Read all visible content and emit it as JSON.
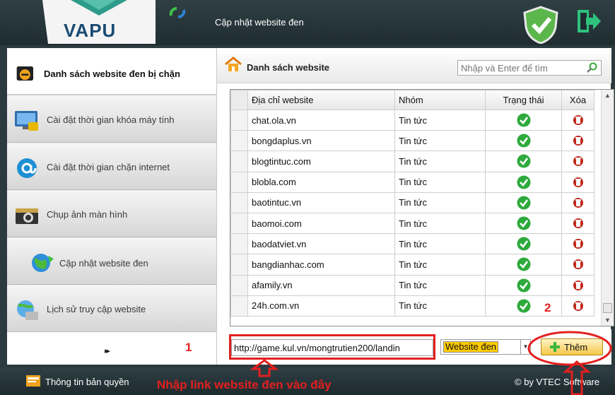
{
  "header": {
    "logo": "VAPU",
    "title": "Cập nhật website đen"
  },
  "sidebar": {
    "items": [
      {
        "label": "Danh sách website đen bị chặn",
        "icon": "blocked-sites-icon"
      },
      {
        "label": "Cài đặt thời gian khóa máy tính",
        "icon": "computer-lock-icon"
      },
      {
        "label": "Cài đặt thời gian chặn internet",
        "icon": "at-sign-icon"
      },
      {
        "label": "Chụp ảnh màn hình",
        "icon": "camera-icon"
      },
      {
        "label": "Cập nhật website đen",
        "icon": "globe-update-icon"
      },
      {
        "label": "Lịch sử truy cập website",
        "icon": "history-icon"
      }
    ],
    "more": "▸▸"
  },
  "main": {
    "title": "Danh sách website",
    "search_placeholder": "Nhập và Enter để tìm",
    "columns": [
      "Địa chỉ website",
      "Nhóm",
      "Trạng thái",
      "Xóa"
    ],
    "rows": [
      {
        "url": "chat.ola.vn",
        "group": "Tin tức"
      },
      {
        "url": "bongdaplus.vn",
        "group": "Tin tức"
      },
      {
        "url": "blogtintuc.com",
        "group": "Tin tức"
      },
      {
        "url": "blobla.com",
        "group": "Tin tức"
      },
      {
        "url": "baotintuc.vn",
        "group": "Tin tức"
      },
      {
        "url": "baomoi.com",
        "group": "Tin tức"
      },
      {
        "url": "baodatviet.vn",
        "group": "Tin tức"
      },
      {
        "url": "bangdianhac.com",
        "group": "Tin tức"
      },
      {
        "url": "afamily.vn",
        "group": "Tin tức"
      },
      {
        "url": "24h.com.vn",
        "group": "Tin tức"
      }
    ],
    "url_input_value": "http://game.kul.vn/mongtrutien200/landin",
    "category_selected": "Website đen",
    "add_label": "Thêm"
  },
  "footer": {
    "license": "Thông tin bản quyền",
    "copyright": "© by VTEC Software"
  },
  "annotations": {
    "num1": "1",
    "num2": "2",
    "hint": "Nhập link website đen vào đây",
    "color": "#e41f1f"
  }
}
